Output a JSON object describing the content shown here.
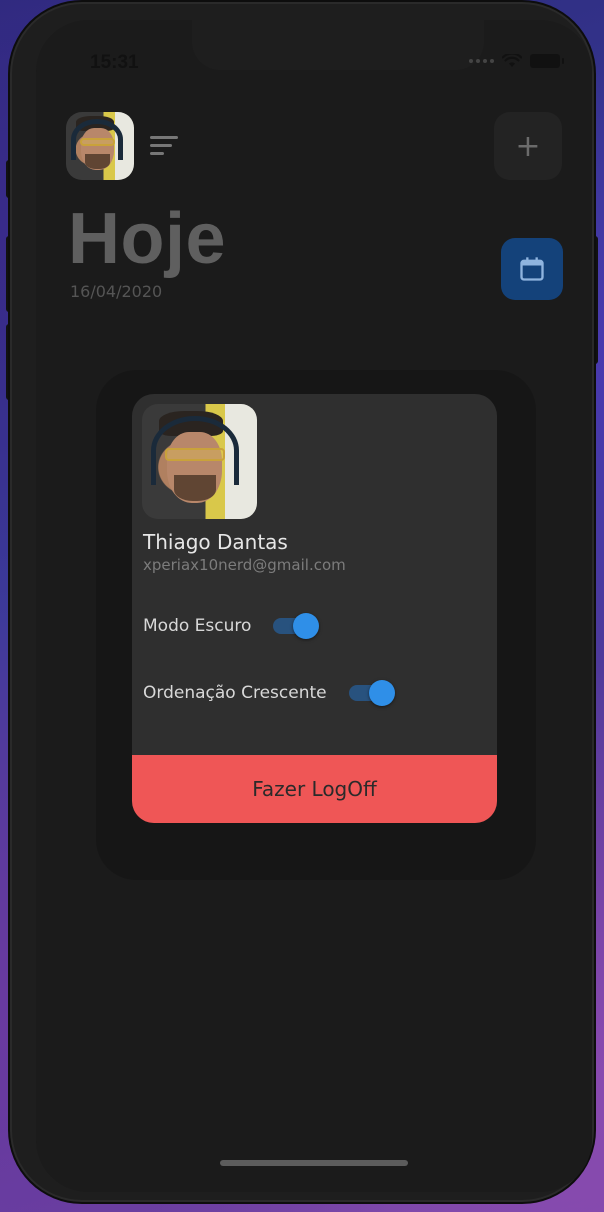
{
  "status_bar": {
    "time": "15:31"
  },
  "header": {
    "add_symbol": "+",
    "title": "Hoje",
    "date": "16/04/2020"
  },
  "profile": {
    "name": "Thiago Dantas",
    "email": "xperiax10nerd@gmail.com"
  },
  "settings": {
    "dark_mode_label": "Modo Escuro",
    "dark_mode_on": true,
    "ascending_order_label": "Ordenação Crescente",
    "ascending_order_on": true
  },
  "actions": {
    "logoff_label": "Fazer LogOff"
  },
  "colors": {
    "accent_blue": "#2f8fe8",
    "logoff_red": "#ef5656",
    "dialog_bg": "#2f2f2f"
  },
  "icons": {
    "menu": "menu-icon",
    "add": "plus-icon",
    "calendar": "calendar-icon"
  }
}
